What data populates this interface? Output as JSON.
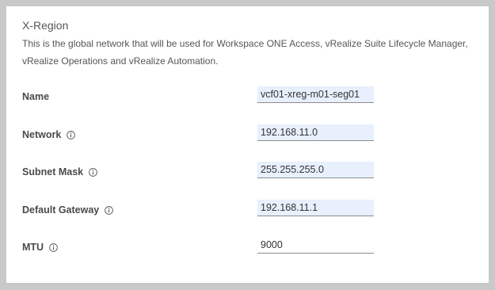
{
  "section": {
    "title": "X-Region",
    "description": "This is the global network that will be used for Workspace ONE Access, vRealize Suite Lifecycle Manager, vRealize Operations and vRealize Automation."
  },
  "fields": {
    "name": {
      "label": "Name",
      "value": "vcf01-xreg-m01-seg01",
      "icon": "none"
    },
    "network": {
      "label": "Network",
      "value": "192.168.11.0",
      "icon": "info-icon"
    },
    "subnet_mask": {
      "label": "Subnet Mask",
      "value": "255.255.255.0",
      "icon": "info-icon"
    },
    "default_gateway": {
      "label": "Default Gateway",
      "value": "192.168.11.1",
      "icon": "info-icon"
    },
    "mtu": {
      "label": "MTU",
      "value": "9000",
      "icon": "info-icon"
    }
  },
  "colors": {
    "autofill_background": "#e8f0fe",
    "page_background": "#c9c9c9",
    "panel_background": "#ffffff"
  }
}
